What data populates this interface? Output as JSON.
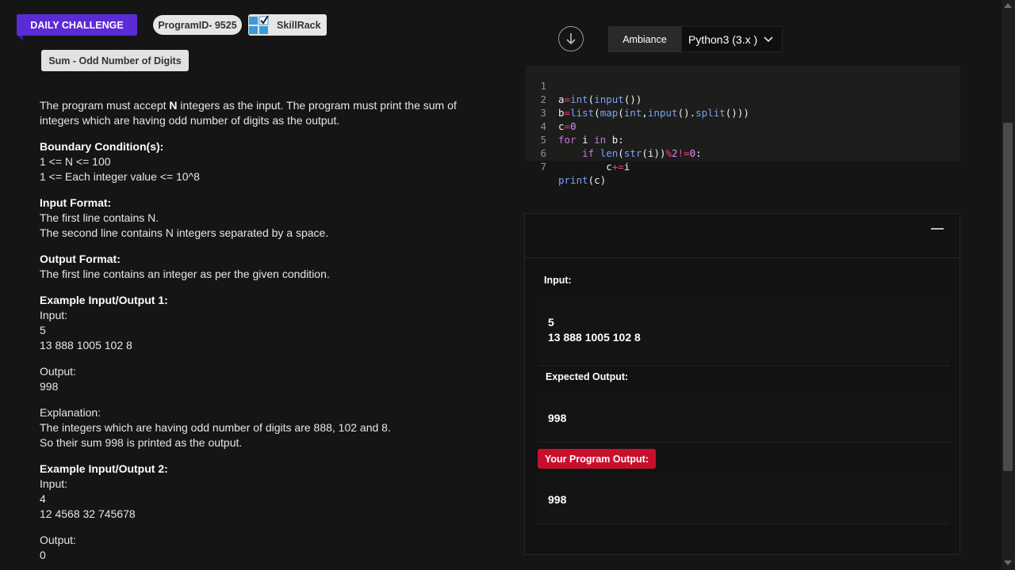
{
  "header": {
    "daily_challenge": "DAILY CHALLENGE",
    "program_id": "ProgramID- 9525",
    "brand": "SkillRack",
    "problem_title": "Sum - Odd Number of Digits"
  },
  "statement": {
    "intro_pre": "The program must accept ",
    "intro_bold": "N",
    "intro_post": " integers as the input. The program must print the sum of integers which are having odd number of digits as the output.",
    "boundary_heading": "Boundary Condition(s):",
    "boundary_lines": [
      "1 <= N <= 100",
      "1 <= Each integer value <= 10^8"
    ],
    "input_heading": "Input Format:",
    "input_lines": [
      "The first line contains N.",
      "The second line contains N integers separated by a space."
    ],
    "output_heading": "Output Format:",
    "output_lines": [
      "The first line contains an integer as per the given condition."
    ],
    "example1_heading": "Example Input/Output 1:",
    "example1_input_lines": [
      "Input:",
      "5",
      "13 888 1005 102 8"
    ],
    "example1_output_lines": [
      "Output:",
      "998"
    ],
    "explanation_lines": [
      "Explanation:",
      "The integers which are having odd number of digits are 888, 102 and 8.",
      "So their sum 998 is printed as the output."
    ],
    "example2_heading": "Example Input/Output 2:",
    "example2_input_lines": [
      "Input:",
      "4",
      "12 4568 32 745678"
    ],
    "example2_output_lines": [
      "Output:",
      "0"
    ]
  },
  "toolbar": {
    "download_icon": "arrow-down-circle-icon",
    "ambiance_label": "Ambiance",
    "language_selected": "Python3 (3.x )"
  },
  "editor": {
    "line_numbers": [
      "1",
      "2",
      "3",
      "4",
      "5",
      "6",
      "7"
    ],
    "code_lines": [
      "a=int(input())",
      "b=list(map(int,input().split()))",
      "c=0",
      "for i in b:",
      "    if len(str(i))%2!=0:",
      "        c+=i",
      "print(c)"
    ]
  },
  "output_panel": {
    "input_label": "Input:",
    "input_lines": [
      "5",
      "13 888 1005 102 8"
    ],
    "expected_label": "Expected Output:",
    "expected_value": "998",
    "program_output_label": "Your Program Output:",
    "program_output_value": "998"
  },
  "colors": {
    "daily_badge": "#5b2bd6",
    "program_output_badge": "#c8102e",
    "background": "#151515"
  }
}
